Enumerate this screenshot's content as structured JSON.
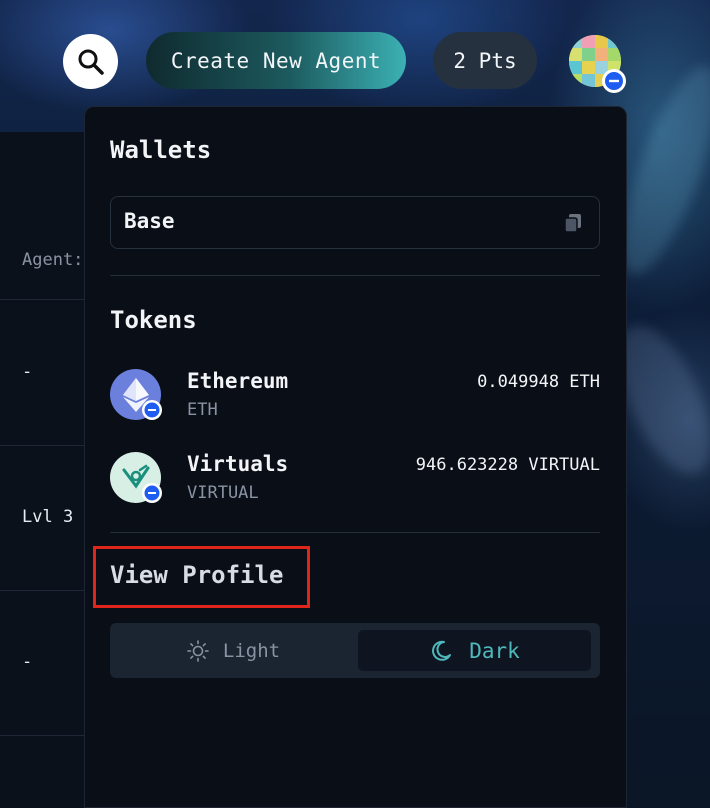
{
  "topbar": {
    "create_label": "Create New Agent",
    "points_label": "2 Pts"
  },
  "left_column": {
    "agent_label": "Agent:",
    "rows": [
      "-",
      "Lvl 3",
      "-"
    ]
  },
  "wallet_panel": {
    "wallets_heading": "Wallets",
    "wallet_name": "Base",
    "tokens_heading": "Tokens",
    "tokens": [
      {
        "name": "Ethereum",
        "symbol": "ETH",
        "balance": "0.049948 ETH",
        "logo_icon": "ethereum-icon",
        "logo_color": "#6b7fdc"
      },
      {
        "name": "Virtuals",
        "symbol": "VIRTUAL",
        "balance": "946.623228 VIRTUAL",
        "logo_icon": "virtuals-icon",
        "logo_color": "#d8efe6"
      }
    ],
    "view_profile_label": "View Profile",
    "theme": {
      "light_label": "Light",
      "dark_label": "Dark",
      "selected": "Dark"
    }
  },
  "colors": {
    "accent": "#4fb8bd",
    "highlight_box": "#e0261b",
    "panel_bg": "#0a0e16"
  }
}
